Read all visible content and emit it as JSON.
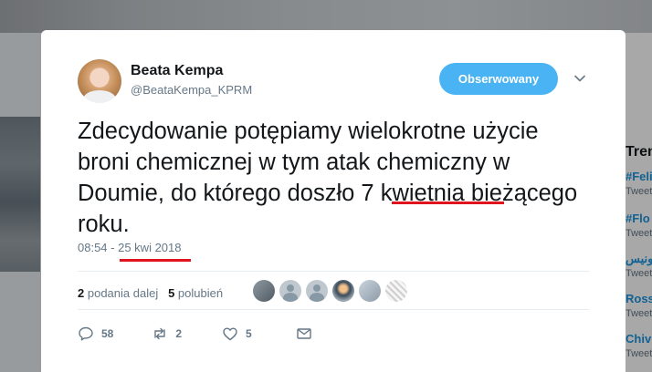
{
  "tweet": {
    "author_name": "Beata Kempa",
    "author_handle": "@BeataKempa_KPRM",
    "follow_label": "Obserwowany",
    "text_before": "Zdecydowanie potępiamy wielokrotne użycie broni chemicznej w tym atak chemiczny w Doumie, do którego doszło ",
    "text_highlight": "7 kwietnia",
    "text_after": " bieżącego roku.",
    "time": "08:54",
    "separator": " - ",
    "date": "25 kwi 2018",
    "retweets_count": "2",
    "retweets_label": "podania dalej",
    "likes_count": "5",
    "likes_label": "polubień",
    "reply_count": "58",
    "retweet_action_count": "2",
    "like_action_count": "5"
  },
  "background": {
    "trends_heading": "Tren",
    "trend_1": "#Feli",
    "trend_1_sub": "Tweet",
    "trend_2": "#Flo",
    "trend_2_sub": "Tweet",
    "trend_3": "لونيس",
    "trend_3_sub": "Tweet",
    "trend_4": "Ross",
    "trend_4_sub": "Tweet",
    "trend_5": "Chiv",
    "trend_5_sub": "Tweet"
  },
  "colors": {
    "accent": "#4ab3f4",
    "annotation_red": "#e0141e",
    "text": "#14171a",
    "muted": "#657786"
  },
  "icons": [
    "chevron-down-icon",
    "reply-icon",
    "retweet-icon",
    "heart-icon",
    "direct-message-icon"
  ]
}
